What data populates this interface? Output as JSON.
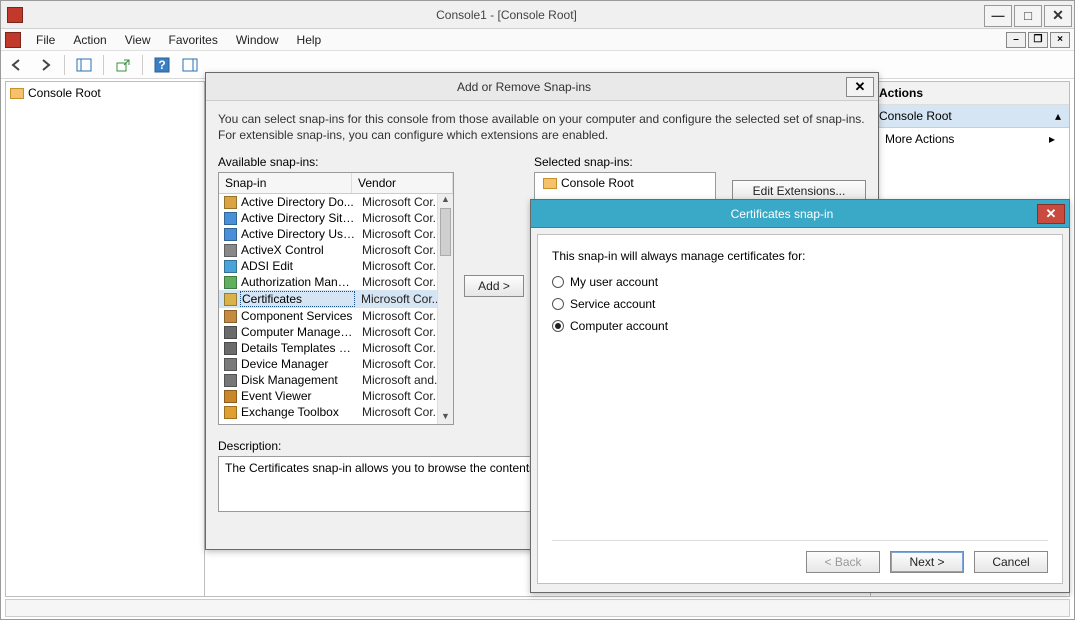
{
  "window": {
    "title": "Console1 - [Console Root]",
    "menu": {
      "file": "File",
      "action": "Action",
      "view": "View",
      "favorites": "Favorites",
      "window": "Window",
      "help": "Help"
    },
    "tree_root": "Console Root"
  },
  "actions_pane": {
    "header": "Actions",
    "section": "Console Root",
    "more": "More Actions"
  },
  "dlg_snapins": {
    "title": "Add or Remove Snap-ins",
    "intro": "You can select snap-ins for this console from those available on your computer and configure the selected set of snap-ins. For extensible snap-ins, you can configure which extensions are enabled.",
    "available_label": "Available snap-ins:",
    "selected_label": "Selected snap-ins:",
    "col_snapin": "Snap-in",
    "col_vendor": "Vendor",
    "add_btn": "Add >",
    "edit_ext_btn": "Edit Extensions...",
    "description_label": "Description:",
    "description_text": "The Certificates snap-in allows you to browse the contents of",
    "selected_root": "Console Root",
    "available": [
      {
        "name": "Active Directory Do...",
        "vendor": "Microsoft Cor..."
      },
      {
        "name": "Active Directory Site...",
        "vendor": "Microsoft Cor..."
      },
      {
        "name": "Active Directory Use...",
        "vendor": "Microsoft Cor..."
      },
      {
        "name": "ActiveX Control",
        "vendor": "Microsoft Cor..."
      },
      {
        "name": "ADSI Edit",
        "vendor": "Microsoft Cor..."
      },
      {
        "name": "Authorization Manager",
        "vendor": "Microsoft Cor..."
      },
      {
        "name": "Certificates",
        "vendor": "Microsoft Cor...",
        "selected": true
      },
      {
        "name": "Component Services",
        "vendor": "Microsoft Cor..."
      },
      {
        "name": "Computer Managem...",
        "vendor": "Microsoft Cor..."
      },
      {
        "name": "Details Templates E...",
        "vendor": "Microsoft Cor..."
      },
      {
        "name": "Device Manager",
        "vendor": "Microsoft Cor..."
      },
      {
        "name": "Disk Management",
        "vendor": "Microsoft and..."
      },
      {
        "name": "Event Viewer",
        "vendor": "Microsoft Cor..."
      },
      {
        "name": "Exchange Toolbox",
        "vendor": "Microsoft Cor..."
      }
    ]
  },
  "dlg_cert": {
    "title": "Certificates snap-in",
    "prompt": "This snap-in will always manage certificates for:",
    "opt_user": "My user account",
    "opt_service": "Service account",
    "opt_computer": "Computer account",
    "selected": "computer",
    "back": "< Back",
    "next": "Next >",
    "cancel": "Cancel"
  }
}
